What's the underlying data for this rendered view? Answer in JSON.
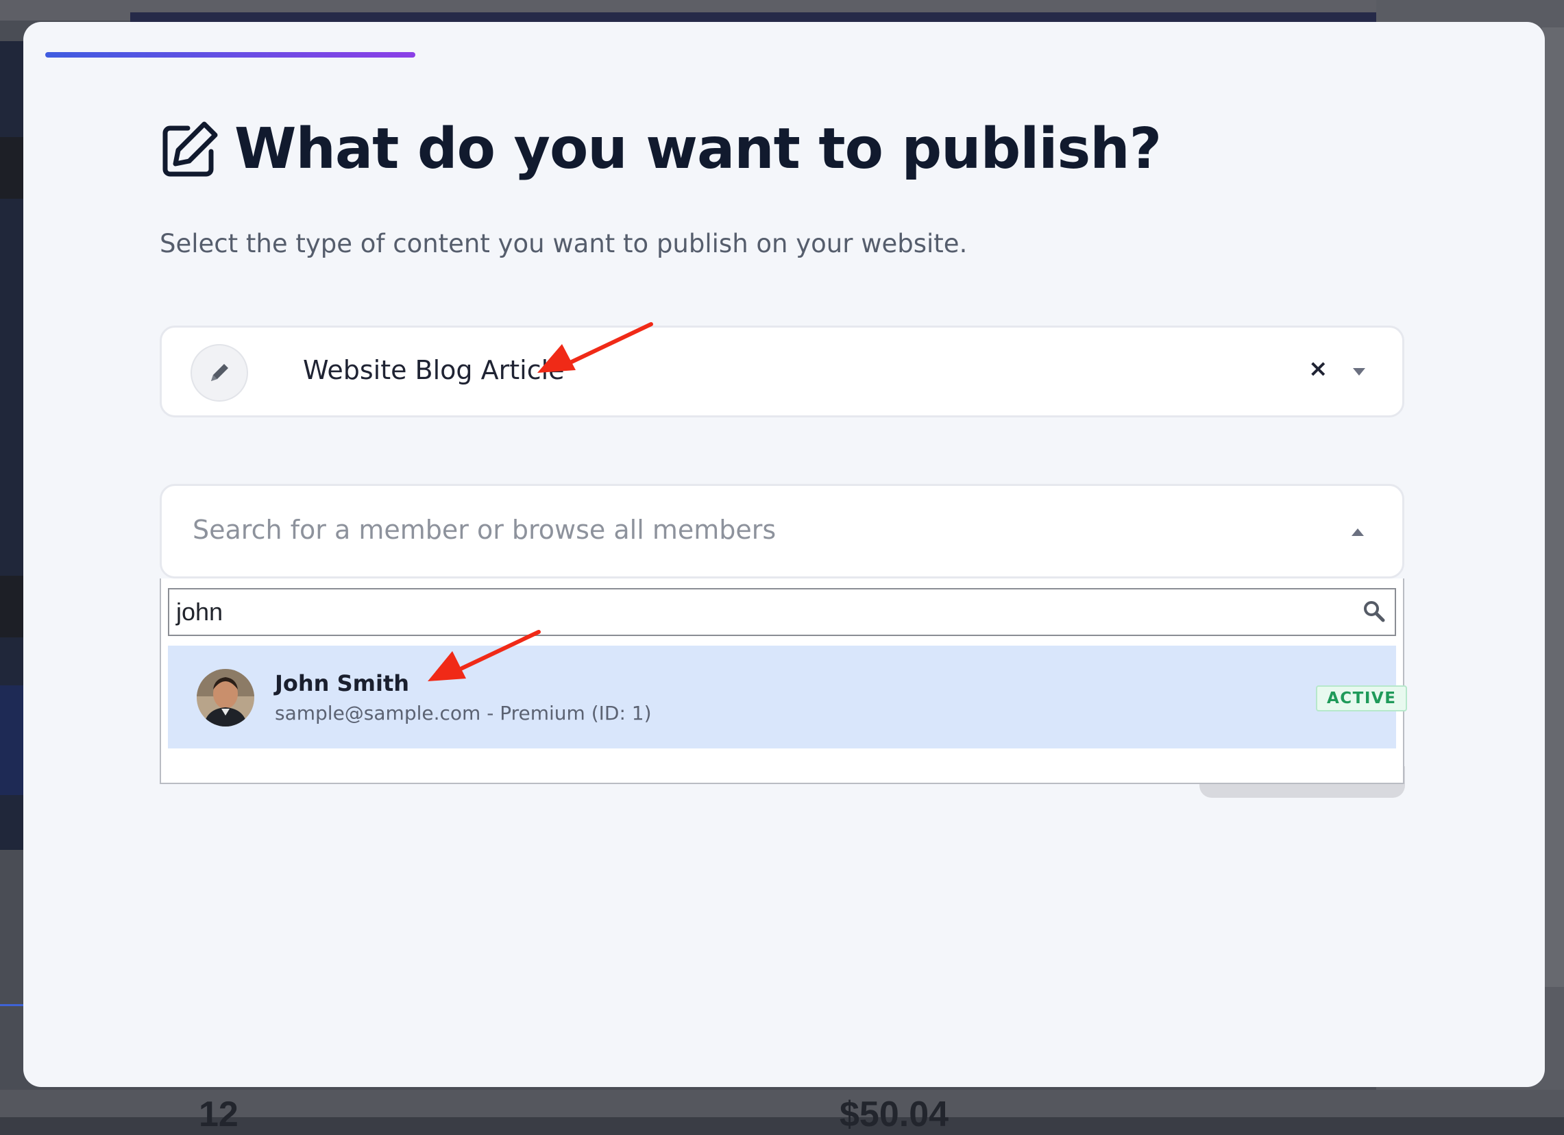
{
  "modal": {
    "title": "What do you want to publish?",
    "subtitle": "Select the type of content you want to publish on your website.",
    "title_icon": "edit-square-icon"
  },
  "content_type_select": {
    "value": "Website Blog Article",
    "icon": "pencil-icon",
    "clear_label": "×"
  },
  "member_select": {
    "placeholder": "Search for a member or browse all members",
    "search_value": "john",
    "search_icon": "magnifier-icon",
    "options": [
      {
        "name": "John Smith",
        "detail": "sample@sample.com - Premium (ID: 1)",
        "status": "ACTIVE"
      }
    ]
  },
  "background": {
    "stat_1": "12",
    "stat_2": "$50.04"
  },
  "colors": {
    "accent_start": "#3f5ce0",
    "accent_end": "#8b3fe6",
    "highlight_row": "#d9e6fb",
    "status_active": "#1f9a5a",
    "annotation_arrow": "#f02a17"
  }
}
